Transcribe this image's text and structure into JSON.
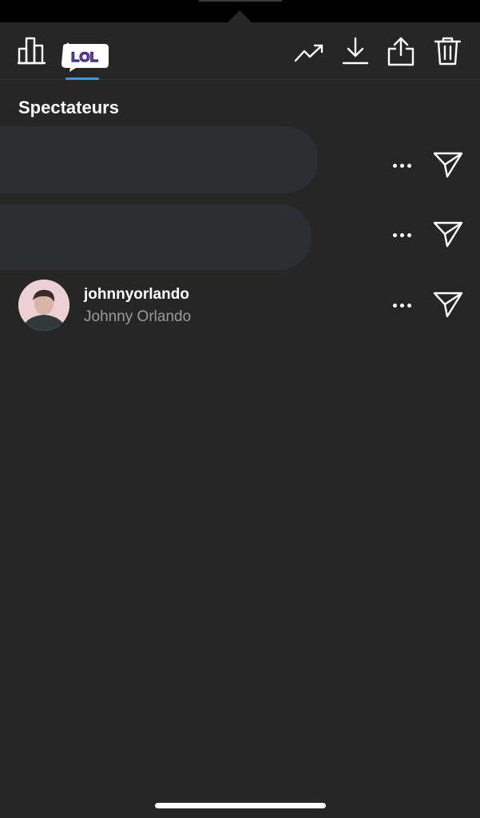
{
  "header": {
    "icons": [
      "bar-chart-icon",
      "lol-sticker-icon",
      "trending-icon",
      "download-icon",
      "share-icon",
      "trash-icon"
    ],
    "sticker_text": "LOL"
  },
  "viewers": {
    "section_title": "Spectateurs",
    "rows": [
      {
        "redacted": true
      },
      {
        "redacted": true
      },
      {
        "username": "johnnyorlando",
        "full_name": "Johnny Orlando"
      }
    ]
  },
  "colors": {
    "background": "#262626",
    "sticker_fill": "#7b4fe0",
    "selected_underline": "#3897f0",
    "secondary_text": "#9b9b9b"
  }
}
